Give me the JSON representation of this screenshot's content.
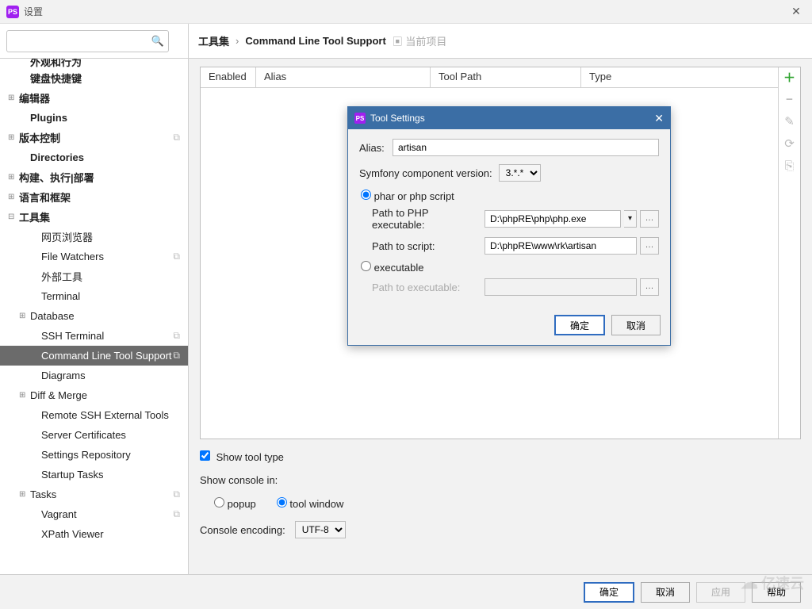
{
  "titlebar": {
    "title": "设置"
  },
  "breadcrumb": {
    "root": "工具集",
    "current": "Command Line Tool Support",
    "scope_icon": "▣",
    "scope": "当前项目"
  },
  "sidebar": {
    "items": [
      {
        "label": "外观和行为",
        "depth": 1,
        "bold": true,
        "cut": true
      },
      {
        "label": "键盘快捷键",
        "depth": 1,
        "bold": true
      },
      {
        "label": "编辑器",
        "depth": 0,
        "bold": true,
        "exp": "⊞"
      },
      {
        "label": "Plugins",
        "depth": 1,
        "bold": true
      },
      {
        "label": "版本控制",
        "depth": 0,
        "bold": true,
        "exp": "⊞",
        "copy": true
      },
      {
        "label": "Directories",
        "depth": 1,
        "bold": true
      },
      {
        "label": "构建、执行|部署",
        "depth": 0,
        "bold": true,
        "exp": "⊞"
      },
      {
        "label": "语言和框架",
        "depth": 0,
        "bold": true,
        "exp": "⊞"
      },
      {
        "label": "工具集",
        "depth": 0,
        "bold": true,
        "exp": "⊟"
      },
      {
        "label": "网页浏览器",
        "depth": 2
      },
      {
        "label": "File Watchers",
        "depth": 2,
        "copy": true
      },
      {
        "label": "外部工具",
        "depth": 2
      },
      {
        "label": "Terminal",
        "depth": 2
      },
      {
        "label": "Database",
        "depth": 1,
        "exp": "⊞"
      },
      {
        "label": "SSH Terminal",
        "depth": 2,
        "copy": true
      },
      {
        "label": "Command Line Tool Support",
        "depth": 2,
        "selected": true,
        "copy": true
      },
      {
        "label": "Diagrams",
        "depth": 2
      },
      {
        "label": "Diff & Merge",
        "depth": 1,
        "exp": "⊞"
      },
      {
        "label": "Remote SSH External Tools",
        "depth": 2
      },
      {
        "label": "Server Certificates",
        "depth": 2
      },
      {
        "label": "Settings Repository",
        "depth": 2
      },
      {
        "label": "Startup Tasks",
        "depth": 2
      },
      {
        "label": "Tasks",
        "depth": 1,
        "exp": "⊞",
        "copy": true
      },
      {
        "label": "Vagrant",
        "depth": 2,
        "copy": true
      },
      {
        "label": "XPath Viewer",
        "depth": 2
      }
    ]
  },
  "table": {
    "headers": {
      "enabled": "Enabled",
      "alias": "Alias",
      "path": "Tool Path",
      "type": "Type"
    }
  },
  "options": {
    "show_tool_type": "Show tool type",
    "show_console_in": "Show console in:",
    "popup": "popup",
    "tool_window": "tool window",
    "console_encoding_label": "Console encoding:",
    "console_encoding": "UTF-8"
  },
  "footer": {
    "ok": "确定",
    "cancel": "取消",
    "apply": "应用",
    "help": "帮助"
  },
  "dialog": {
    "title": "Tool Settings",
    "alias_label": "Alias:",
    "alias_value": "artisan",
    "version_label": "Symfony component version:",
    "version_value": "3.*.*",
    "radio_phar": "phar or php script",
    "php_path_label": "Path to PHP executable:",
    "php_path_value": "D:\\phpRE\\php\\php.exe",
    "script_path_label": "Path to script:",
    "script_path_value": "D:\\phpRE\\www\\rk\\artisan",
    "radio_exec": "executable",
    "exec_path_label": "Path to executable:",
    "ok": "确定",
    "cancel": "取消"
  },
  "watermark": "亿速云"
}
